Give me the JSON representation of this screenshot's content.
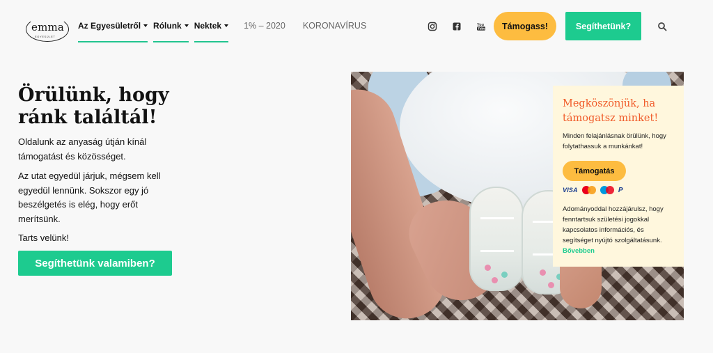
{
  "logo": {
    "word": "emma",
    "sub": "EGYESÜLET"
  },
  "nav": {
    "menu": [
      {
        "label": "Az Egyesületről"
      },
      {
        "label": "Rólunk"
      },
      {
        "label": "Nektek"
      }
    ],
    "links": [
      {
        "label": "1% – 2020"
      },
      {
        "label": "KORONAVÍRUS"
      }
    ],
    "social_icons": [
      "instagram-icon",
      "facebook-icon",
      "youtube-icon"
    ],
    "support_button": "Támogass!",
    "help_button": "Segíthetünk?",
    "search_icon": "search-icon"
  },
  "hero": {
    "title": "Örülünk, hogy ránk találtál!",
    "paragraph1": "Oldalunk az anyaság útján kínál támogatást és közösséget.",
    "paragraph2": "Az utat egyedül járjuk, mégsem kell egyedül lennünk. Sokszor egy jó beszélgetés is elég, hogy erőt merítsünk.",
    "paragraph3": "Tarts velünk!",
    "cta": "Segíthetünk valamiben?"
  },
  "donation": {
    "title": "Megköszönjük, ha támogatsz minket!",
    "text": "Minden felajánlásnak örülünk, hogy folytathassuk a munkánkat!",
    "button": "Támogatás",
    "payments": {
      "visa": "VISA",
      "paypal": "P"
    },
    "text2": "Adományoddal hozzájárulsz, hogy fenntartsuk születési jogokkal kapcsolatos információs, és segítséget nyújtó szolgáltatásunk.",
    "more": "Bővebben"
  },
  "colors": {
    "accent_green": "#1dcb8f",
    "accent_yellow": "#fdbc40",
    "card_title_orange": "#f05a28",
    "card_bg": "#fff7dd",
    "mastercard_red": "#eb001b",
    "mastercard_orange": "#f79e1b",
    "maestro_blue": "#0099df"
  }
}
